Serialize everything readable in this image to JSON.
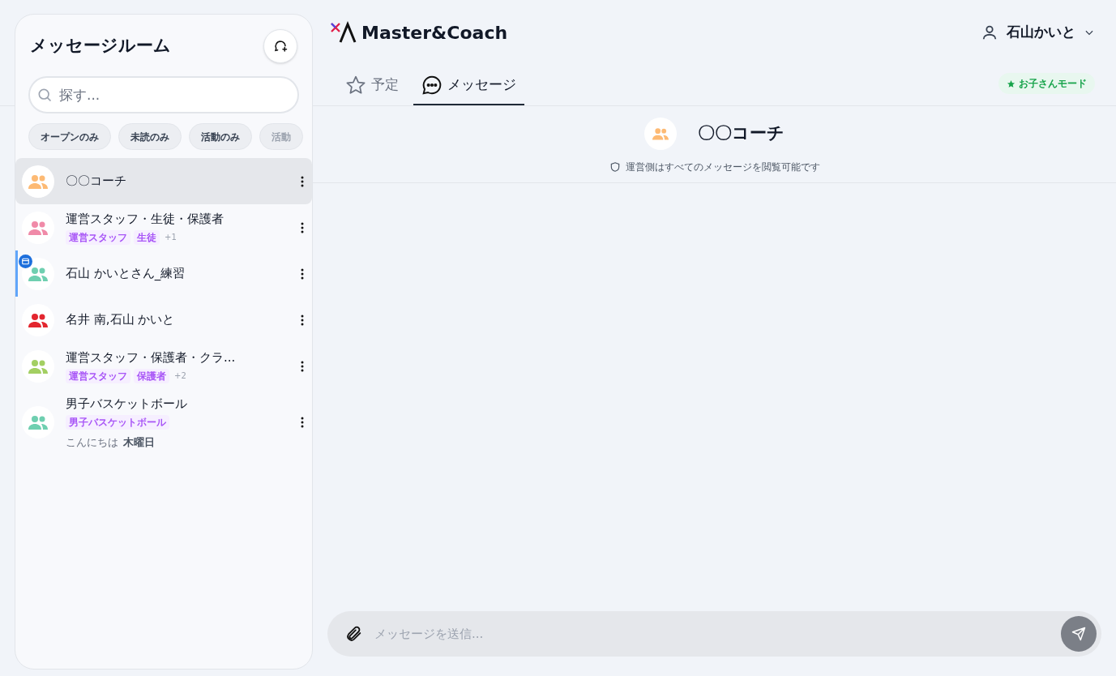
{
  "sidebar": {
    "title": "メッセージルーム",
    "search": {
      "placeholder": "探す..."
    },
    "filters": [
      {
        "label": "オープンのみ",
        "faded": false
      },
      {
        "label": "未読のみ",
        "faded": false
      },
      {
        "label": "活動のみ",
        "faded": false
      },
      {
        "label": "活動",
        "faded": true
      }
    ],
    "rooms": [
      {
        "name": "〇〇コーチ",
        "color": "#fdba74",
        "selected": true,
        "event": false
      },
      {
        "name": "運営スタッフ・生徒・保護者",
        "color": "#f08aa8",
        "selected": false,
        "event": false,
        "tags": [
          "運営スタッフ",
          "生徒"
        ],
        "more": "+1"
      },
      {
        "name": "石山 かいとさん_練習",
        "color": "#6fcfb0",
        "selected": false,
        "event": true
      },
      {
        "name": "名井 南,石山 かいと",
        "color": "#e3262f",
        "selected": false,
        "event": false
      },
      {
        "name": "運営スタッフ・保護者・クラ...",
        "color": "#a3cf62",
        "selected": false,
        "event": false,
        "tags": [
          "運営スタッフ",
          "保護者"
        ],
        "more": "+2"
      },
      {
        "name": "男子バスケットボール",
        "color": "#6fcfb0",
        "selected": false,
        "event": false,
        "tags": [
          "男子バスケットボール"
        ],
        "preview": "こんにちは",
        "preview_time": "木曜日"
      }
    ]
  },
  "header": {
    "logo": "Master&Coach",
    "user": "石山かいと",
    "mode_badge": "お子さんモード"
  },
  "tabs": [
    {
      "label": "予定",
      "selected": false
    },
    {
      "label": "メッセージ",
      "selected": true
    }
  ],
  "chat": {
    "title": "〇〇コーチ",
    "notice": "運営側はすべてのメッセージを閲覧可能です",
    "composer": {
      "placeholder": "メッセージを送信..."
    }
  }
}
